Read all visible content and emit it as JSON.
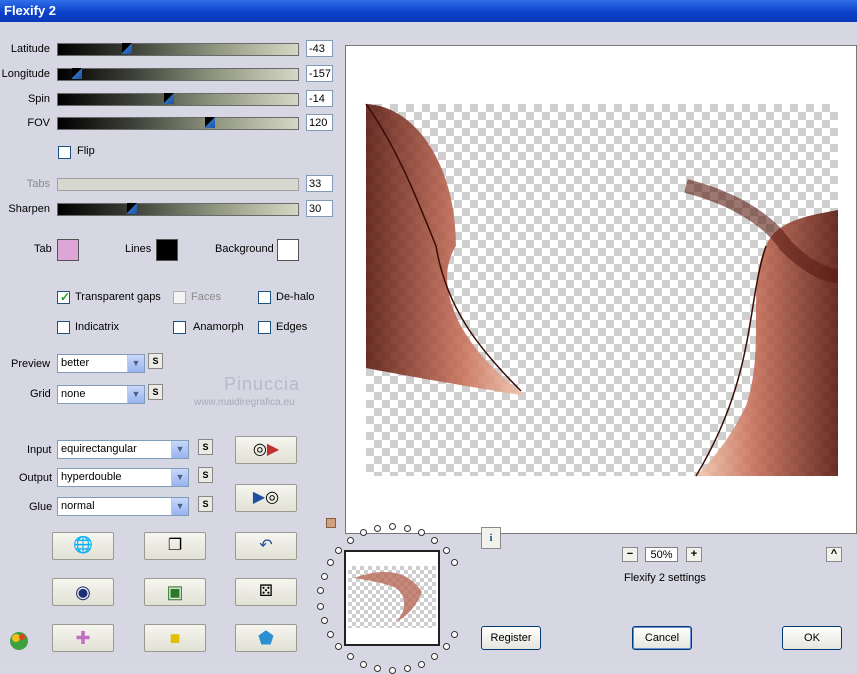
{
  "window": {
    "title": "Flexify 2"
  },
  "sliders": [
    {
      "label": "Latitude",
      "value": "-43",
      "level": 0.28
    },
    {
      "label": "Longitude",
      "value": "-157",
      "level": 0.06
    },
    {
      "label": "Spin",
      "value": "-14",
      "level": 0.46
    },
    {
      "label": "FOV",
      "value": "120",
      "level": 0.64
    },
    {
      "label": "Tabs",
      "value": "33",
      "level": 0.0,
      "disabled": true
    },
    {
      "label": "Sharpen",
      "value": "30",
      "level": 0.3
    }
  ],
  "flip": {
    "label": "Flip",
    "checked": false
  },
  "colors": {
    "tab": {
      "label": "Tab",
      "value": "#dca6d6"
    },
    "lines": {
      "label": "Lines",
      "value": "#000000"
    },
    "background": {
      "label": "Background",
      "value": "#ffffff"
    }
  },
  "options": {
    "transparent_gaps": {
      "label": "Transparent gaps",
      "checked": true
    },
    "faces": {
      "label": "Faces",
      "checked": false,
      "disabled": true
    },
    "de_halo": {
      "label": "De-halo",
      "checked": false
    },
    "indicatrix": {
      "label": "Indicatrix",
      "checked": false
    },
    "anamorph": {
      "label": "Anamorph",
      "checked": false
    },
    "edges": {
      "label": "Edges",
      "checked": false
    }
  },
  "preview_select": {
    "label": "Preview",
    "value": "better",
    "s_label": "S"
  },
  "grid_select": {
    "label": "Grid",
    "value": "none",
    "s_label": "S"
  },
  "input_select": {
    "label": "Input",
    "value": "equirectangular",
    "s_label": "S"
  },
  "output_select": {
    "label": "Output",
    "value": "hyperdouble",
    "s_label": "S"
  },
  "glue_select": {
    "label": "Glue",
    "value": "normal",
    "s_label": "S"
  },
  "watermark": {
    "name": "Pinuccia",
    "url": "www.maidiregrafica.eu"
  },
  "zoom": {
    "value": "50%",
    "minus": "−",
    "plus": "+"
  },
  "info_icon": "i",
  "collapse": "^",
  "settings_label": "Flexify 2 settings",
  "buttons": {
    "register": "Register",
    "cancel": "Cancel",
    "ok": "OK"
  },
  "accent": "#2f6fe8"
}
